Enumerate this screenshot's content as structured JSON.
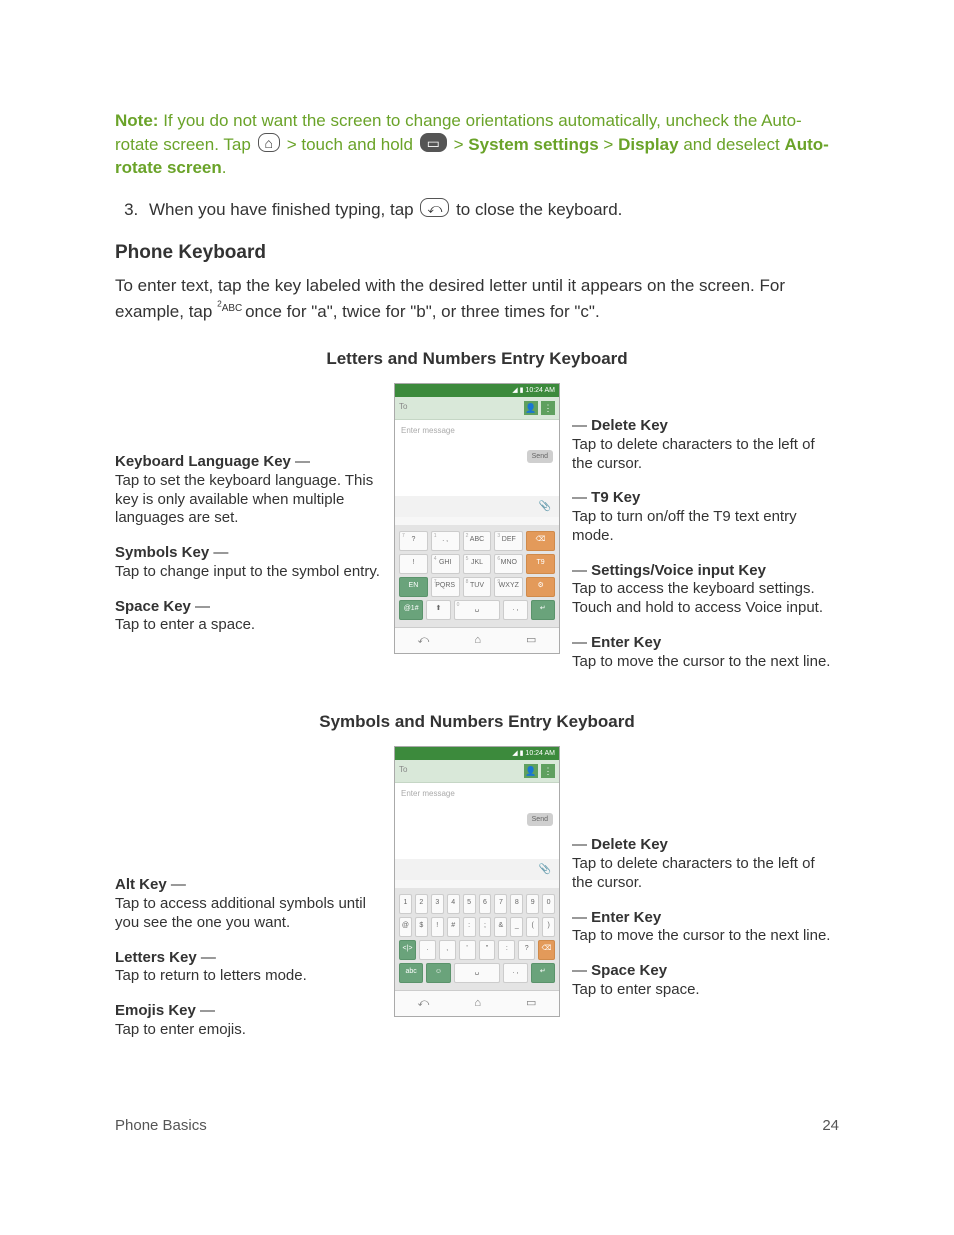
{
  "note": {
    "prefix": "Note:",
    "sentence1": "If you do not want the screen to change orientations automatically, uncheck the Auto-rotate screen. Tap",
    "mid1": "> touch and hold",
    "mid2": ">",
    "sys": "System settings",
    "mid3": ">",
    "display": "Display",
    "mid4": "and deselect",
    "auto": "Auto-rotate screen",
    "period": "."
  },
  "step3": {
    "num": "3.",
    "pre": "When you have finished typing, tap",
    "post": "to close the keyboard."
  },
  "phone_kbd_title": "Phone Keyboard",
  "phone_kbd_para1": "To enter text, tap the key labeled with the desired letter until it appears on the screen. For example, tap",
  "abc_key": "ABC",
  "abc_sup": "2",
  "phone_kbd_para2": "once for \"a\", twice for \"b\", or three times for \"c\".",
  "diagram1": {
    "title": "Letters and Numbers Entry Keyboard",
    "left": [
      {
        "title": "Keyboard Language Key",
        "desc": "Tap to set the keyboard language. This key is only available when multiple languages are set."
      },
      {
        "title": "Symbols Key",
        "desc": "Tap to change input to the symbol entry."
      },
      {
        "title": "Space Key",
        "desc": "Tap to enter a space."
      }
    ],
    "right": [
      {
        "title": "Delete Key",
        "desc": "Tap to delete characters to the left of the cursor."
      },
      {
        "title": "T9 Key",
        "desc": "Tap to turn on/off the T9 text entry mode."
      },
      {
        "title": "Settings/Voice input Key",
        "desc": "Tap to access the keyboard settings. Touch and hold to access Voice input."
      },
      {
        "title": "Enter Key",
        "desc": "Tap to move the cursor to the next line."
      }
    ],
    "phone": {
      "time": "10:24 AM",
      "to": "To",
      "msg": "Enter message",
      "send": "Send",
      "rows": [
        [
          "?",
          ". ,",
          "ABC",
          "DEF",
          "⌫"
        ],
        [
          "!",
          "GHI",
          "JKL",
          "MNO",
          "T9"
        ],
        [
          "EN",
          "PQRS",
          "TUV",
          "WXYZ",
          "⚙"
        ],
        [
          "@1#",
          "⬆",
          "␣",
          ". ,",
          "↵"
        ]
      ]
    }
  },
  "diagram2": {
    "title": "Symbols and Numbers Entry Keyboard",
    "left": [
      {
        "title": "Alt Key",
        "desc": "Tap to access additional symbols until you see the one you want."
      },
      {
        "title": "Letters Key",
        "desc": "Tap to return to letters mode."
      },
      {
        "title": "Emojis Key",
        "desc": "Tap to enter emojis."
      }
    ],
    "right": [
      {
        "title": "Delete Key",
        "desc": "Tap to delete characters to the left of the cursor."
      },
      {
        "title": "Enter Key",
        "desc": "Tap to move the cursor to the next line."
      },
      {
        "title": "Space Key",
        "desc": "Tap to enter space."
      }
    ],
    "phone": {
      "time": "10:24 AM",
      "to": "To",
      "msg": "Enter message",
      "send": "Send",
      "rows": [
        [
          "1",
          "2",
          "3",
          "4",
          "5",
          "6",
          "7",
          "8",
          "9",
          "0"
        ],
        [
          "@",
          "$",
          "!",
          "#",
          ":",
          ";",
          "&",
          "_",
          "(",
          ")"
        ],
        [
          "<|>",
          ".",
          ",",
          "'",
          "\"",
          ":",
          "?",
          "⌫"
        ],
        [
          "abc",
          "☺",
          "␣",
          ". ,",
          "↵"
        ]
      ]
    }
  },
  "footer": {
    "left": "Phone Basics",
    "right": "24"
  }
}
